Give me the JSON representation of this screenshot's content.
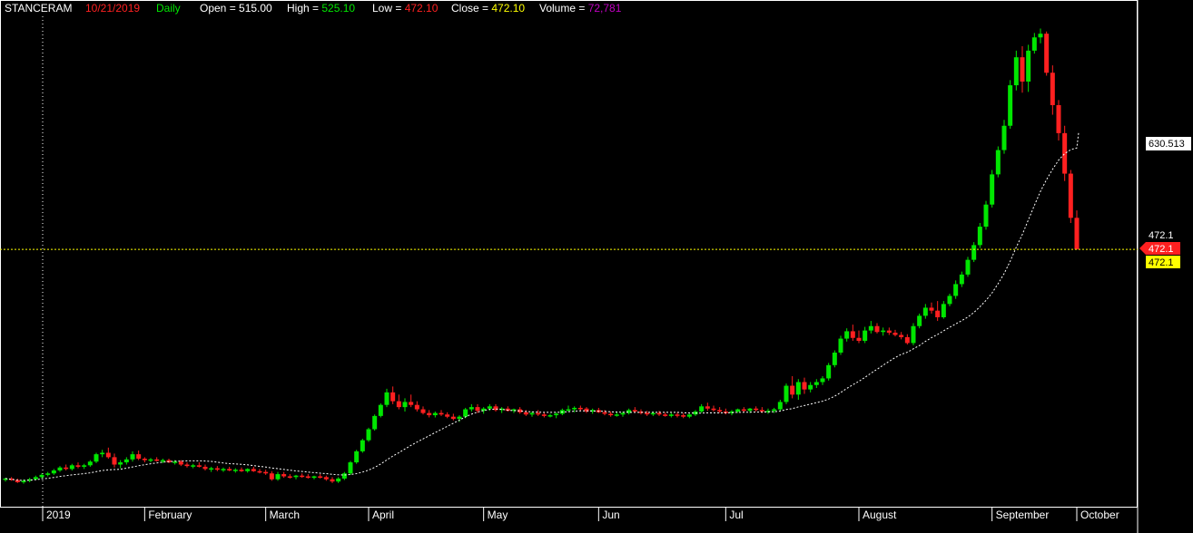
{
  "header": {
    "symbol": "STANCERAM",
    "date": "10/21/2019",
    "period": "Daily",
    "open_label": "Open = 515.00",
    "high_label": "High = ",
    "high_value": "525.10",
    "low_label": "Low = ",
    "low_value": "472.10",
    "close_label": "Close = ",
    "close_value": "472.10",
    "volume_label": "Volume = ",
    "volume_value": "72,781"
  },
  "price_axis": {
    "ma_value_label": "630.513",
    "last_price_label": "472.1",
    "close_marker_label": "472.1",
    "yellow_marker_label": "472.1"
  },
  "colors": {
    "up": "#00e600",
    "down": "#ff2020",
    "background": "#000000",
    "frame": "#ffffff",
    "date_red": "#ff2020",
    "period_green": "#00e600",
    "high_green": "#00e600",
    "low_red": "#ff2020",
    "close_yellow": "#ffff00",
    "volume_magenta": "#c000c0",
    "price_line": "#ffff00"
  },
  "chart_data": {
    "type": "candlestick",
    "x_axis_labels": [
      "2019",
      "February",
      "March",
      "April",
      "May",
      "Jun",
      "Jul",
      "August",
      "September",
      "October"
    ],
    "y_range": [
      140,
      780
    ],
    "overlay": "moving-average (dotted white)",
    "last_close": 472.1,
    "ma_last": 630.513,
    "candles": [
      {
        "o": 160,
        "h": 162,
        "l": 157,
        "c": 161
      },
      {
        "o": 161,
        "h": 163,
        "l": 158,
        "c": 159
      },
      {
        "o": 159,
        "h": 161,
        "l": 155,
        "c": 156
      },
      {
        "o": 156,
        "h": 160,
        "l": 154,
        "c": 158
      },
      {
        "o": 158,
        "h": 162,
        "l": 156,
        "c": 160
      },
      {
        "o": 160,
        "h": 165,
        "l": 159,
        "c": 163
      },
      {
        "o": 163,
        "h": 168,
        "l": 161,
        "c": 166
      },
      {
        "o": 166,
        "h": 170,
        "l": 164,
        "c": 168
      },
      {
        "o": 168,
        "h": 174,
        "l": 166,
        "c": 172
      },
      {
        "o": 172,
        "h": 178,
        "l": 170,
        "c": 176
      },
      {
        "o": 176,
        "h": 180,
        "l": 172,
        "c": 174
      },
      {
        "o": 174,
        "h": 181,
        "l": 172,
        "c": 179
      },
      {
        "o": 179,
        "h": 183,
        "l": 175,
        "c": 177
      },
      {
        "o": 177,
        "h": 181,
        "l": 174,
        "c": 179
      },
      {
        "o": 179,
        "h": 186,
        "l": 177,
        "c": 184
      },
      {
        "o": 184,
        "h": 196,
        "l": 182,
        "c": 194
      },
      {
        "o": 194,
        "h": 200,
        "l": 190,
        "c": 196
      },
      {
        "o": 196,
        "h": 203,
        "l": 188,
        "c": 190
      },
      {
        "o": 190,
        "h": 195,
        "l": 176,
        "c": 180
      },
      {
        "o": 180,
        "h": 186,
        "l": 175,
        "c": 183
      },
      {
        "o": 183,
        "h": 190,
        "l": 180,
        "c": 187
      },
      {
        "o": 187,
        "h": 198,
        "l": 184,
        "c": 194
      },
      {
        "o": 194,
        "h": 199,
        "l": 186,
        "c": 188
      },
      {
        "o": 188,
        "h": 190,
        "l": 183,
        "c": 186
      },
      {
        "o": 186,
        "h": 189,
        "l": 183,
        "c": 187
      },
      {
        "o": 187,
        "h": 190,
        "l": 184,
        "c": 185
      },
      {
        "o": 185,
        "h": 188,
        "l": 182,
        "c": 186
      },
      {
        "o": 186,
        "h": 188,
        "l": 182,
        "c": 183
      },
      {
        "o": 183,
        "h": 186,
        "l": 180,
        "c": 184
      },
      {
        "o": 184,
        "h": 186,
        "l": 178,
        "c": 180
      },
      {
        "o": 180,
        "h": 183,
        "l": 176,
        "c": 178
      },
      {
        "o": 178,
        "h": 181,
        "l": 175,
        "c": 179
      },
      {
        "o": 179,
        "h": 183,
        "l": 176,
        "c": 177
      },
      {
        "o": 177,
        "h": 180,
        "l": 172,
        "c": 174
      },
      {
        "o": 174,
        "h": 177,
        "l": 170,
        "c": 175
      },
      {
        "o": 175,
        "h": 178,
        "l": 171,
        "c": 173
      },
      {
        "o": 173,
        "h": 176,
        "l": 170,
        "c": 174
      },
      {
        "o": 174,
        "h": 177,
        "l": 171,
        "c": 172
      },
      {
        "o": 172,
        "h": 175,
        "l": 169,
        "c": 173
      },
      {
        "o": 173,
        "h": 176,
        "l": 170,
        "c": 171
      },
      {
        "o": 171,
        "h": 175,
        "l": 169,
        "c": 174
      },
      {
        "o": 174,
        "h": 177,
        "l": 170,
        "c": 171
      },
      {
        "o": 171,
        "h": 174,
        "l": 168,
        "c": 170
      },
      {
        "o": 170,
        "h": 173,
        "l": 166,
        "c": 168
      },
      {
        "o": 168,
        "h": 171,
        "l": 158,
        "c": 160
      },
      {
        "o": 160,
        "h": 170,
        "l": 158,
        "c": 167
      },
      {
        "o": 167,
        "h": 170,
        "l": 162,
        "c": 164
      },
      {
        "o": 164,
        "h": 167,
        "l": 161,
        "c": 163
      },
      {
        "o": 163,
        "h": 166,
        "l": 160,
        "c": 165
      },
      {
        "o": 165,
        "h": 168,
        "l": 162,
        "c": 164
      },
      {
        "o": 164,
        "h": 167,
        "l": 161,
        "c": 162
      },
      {
        "o": 162,
        "h": 165,
        "l": 160,
        "c": 164
      },
      {
        "o": 164,
        "h": 167,
        "l": 161,
        "c": 163
      },
      {
        "o": 163,
        "h": 165,
        "l": 158,
        "c": 160
      },
      {
        "o": 160,
        "h": 163,
        "l": 155,
        "c": 157
      },
      {
        "o": 157,
        "h": 163,
        "l": 155,
        "c": 161
      },
      {
        "o": 161,
        "h": 170,
        "l": 159,
        "c": 168
      },
      {
        "o": 168,
        "h": 185,
        "l": 166,
        "c": 183
      },
      {
        "o": 183,
        "h": 200,
        "l": 181,
        "c": 198
      },
      {
        "o": 198,
        "h": 215,
        "l": 196,
        "c": 213
      },
      {
        "o": 213,
        "h": 230,
        "l": 211,
        "c": 228
      },
      {
        "o": 228,
        "h": 248,
        "l": 226,
        "c": 246
      },
      {
        "o": 246,
        "h": 263,
        "l": 244,
        "c": 261
      },
      {
        "o": 261,
        "h": 283,
        "l": 258,
        "c": 278
      },
      {
        "o": 278,
        "h": 286,
        "l": 262,
        "c": 266
      },
      {
        "o": 266,
        "h": 275,
        "l": 255,
        "c": 258
      },
      {
        "o": 258,
        "h": 270,
        "l": 252,
        "c": 265
      },
      {
        "o": 265,
        "h": 275,
        "l": 258,
        "c": 261
      },
      {
        "o": 261,
        "h": 266,
        "l": 252,
        "c": 255
      },
      {
        "o": 255,
        "h": 259,
        "l": 248,
        "c": 250
      },
      {
        "o": 250,
        "h": 254,
        "l": 244,
        "c": 247
      },
      {
        "o": 247,
        "h": 252,
        "l": 244,
        "c": 250
      },
      {
        "o": 250,
        "h": 254,
        "l": 246,
        "c": 248
      },
      {
        "o": 248,
        "h": 251,
        "l": 243,
        "c": 245
      },
      {
        "o": 245,
        "h": 249,
        "l": 240,
        "c": 242
      },
      {
        "o": 242,
        "h": 247,
        "l": 238,
        "c": 245
      },
      {
        "o": 245,
        "h": 257,
        "l": 243,
        "c": 255
      },
      {
        "o": 255,
        "h": 262,
        "l": 252,
        "c": 258
      },
      {
        "o": 258,
        "h": 262,
        "l": 250,
        "c": 253
      },
      {
        "o": 253,
        "h": 258,
        "l": 249,
        "c": 256
      },
      {
        "o": 256,
        "h": 262,
        "l": 253,
        "c": 259
      },
      {
        "o": 259,
        "h": 262,
        "l": 252,
        "c": 254
      },
      {
        "o": 254,
        "h": 258,
        "l": 250,
        "c": 256
      },
      {
        "o": 256,
        "h": 259,
        "l": 252,
        "c": 253
      },
      {
        "o": 253,
        "h": 256,
        "l": 250,
        "c": 255
      },
      {
        "o": 255,
        "h": 258,
        "l": 249,
        "c": 251
      },
      {
        "o": 251,
        "h": 254,
        "l": 246,
        "c": 248
      },
      {
        "o": 248,
        "h": 252,
        "l": 245,
        "c": 250
      },
      {
        "o": 250,
        "h": 254,
        "l": 246,
        "c": 248
      },
      {
        "o": 248,
        "h": 251,
        "l": 244,
        "c": 246
      },
      {
        "o": 246,
        "h": 249,
        "l": 244,
        "c": 247
      },
      {
        "o": 247,
        "h": 251,
        "l": 243,
        "c": 249
      },
      {
        "o": 249,
        "h": 256,
        "l": 247,
        "c": 254
      },
      {
        "o": 254,
        "h": 260,
        "l": 252,
        "c": 255
      },
      {
        "o": 255,
        "h": 259,
        "l": 251,
        "c": 257
      },
      {
        "o": 257,
        "h": 260,
        "l": 253,
        "c": 256
      },
      {
        "o": 256,
        "h": 258,
        "l": 250,
        "c": 252
      },
      {
        "o": 252,
        "h": 256,
        "l": 249,
        "c": 254
      },
      {
        "o": 254,
        "h": 257,
        "l": 250,
        "c": 251
      },
      {
        "o": 251,
        "h": 254,
        "l": 247,
        "c": 249
      },
      {
        "o": 249,
        "h": 252,
        "l": 245,
        "c": 247
      },
      {
        "o": 247,
        "h": 251,
        "l": 245,
        "c": 248
      },
      {
        "o": 248,
        "h": 252,
        "l": 245,
        "c": 250
      },
      {
        "o": 250,
        "h": 256,
        "l": 248,
        "c": 254
      },
      {
        "o": 254,
        "h": 258,
        "l": 250,
        "c": 252
      },
      {
        "o": 252,
        "h": 255,
        "l": 248,
        "c": 250
      },
      {
        "o": 250,
        "h": 253,
        "l": 246,
        "c": 249
      },
      {
        "o": 249,
        "h": 252,
        "l": 246,
        "c": 250
      },
      {
        "o": 250,
        "h": 253,
        "l": 246,
        "c": 248
      },
      {
        "o": 248,
        "h": 251,
        "l": 245,
        "c": 246
      },
      {
        "o": 246,
        "h": 250,
        "l": 244,
        "c": 248
      },
      {
        "o": 248,
        "h": 251,
        "l": 244,
        "c": 247
      },
      {
        "o": 247,
        "h": 250,
        "l": 243,
        "c": 245
      },
      {
        "o": 245,
        "h": 249,
        "l": 243,
        "c": 248
      },
      {
        "o": 248,
        "h": 254,
        "l": 246,
        "c": 252
      },
      {
        "o": 252,
        "h": 262,
        "l": 250,
        "c": 259
      },
      {
        "o": 259,
        "h": 264,
        "l": 253,
        "c": 256
      },
      {
        "o": 256,
        "h": 260,
        "l": 252,
        "c": 254
      },
      {
        "o": 254,
        "h": 258,
        "l": 250,
        "c": 252
      },
      {
        "o": 252,
        "h": 256,
        "l": 248,
        "c": 250
      },
      {
        "o": 250,
        "h": 254,
        "l": 247,
        "c": 252
      },
      {
        "o": 252,
        "h": 256,
        "l": 250,
        "c": 255
      },
      {
        "o": 255,
        "h": 258,
        "l": 251,
        "c": 253
      },
      {
        "o": 253,
        "h": 257,
        "l": 250,
        "c": 256
      },
      {
        "o": 256,
        "h": 259,
        "l": 252,
        "c": 254
      },
      {
        "o": 254,
        "h": 258,
        "l": 250,
        "c": 252
      },
      {
        "o": 252,
        "h": 256,
        "l": 249,
        "c": 253
      },
      {
        "o": 253,
        "h": 257,
        "l": 250,
        "c": 255
      },
      {
        "o": 255,
        "h": 268,
        "l": 253,
        "c": 265
      },
      {
        "o": 265,
        "h": 290,
        "l": 262,
        "c": 287
      },
      {
        "o": 287,
        "h": 300,
        "l": 270,
        "c": 275
      },
      {
        "o": 275,
        "h": 296,
        "l": 268,
        "c": 292
      },
      {
        "o": 292,
        "h": 298,
        "l": 276,
        "c": 282
      },
      {
        "o": 282,
        "h": 292,
        "l": 278,
        "c": 288
      },
      {
        "o": 288,
        "h": 296,
        "l": 284,
        "c": 292
      },
      {
        "o": 292,
        "h": 300,
        "l": 288,
        "c": 297
      },
      {
        "o": 297,
        "h": 318,
        "l": 294,
        "c": 315
      },
      {
        "o": 315,
        "h": 335,
        "l": 312,
        "c": 332
      },
      {
        "o": 332,
        "h": 355,
        "l": 329,
        "c": 351
      },
      {
        "o": 351,
        "h": 365,
        "l": 347,
        "c": 361
      },
      {
        "o": 361,
        "h": 370,
        "l": 348,
        "c": 352
      },
      {
        "o": 352,
        "h": 362,
        "l": 345,
        "c": 348
      },
      {
        "o": 348,
        "h": 367,
        "l": 345,
        "c": 362
      },
      {
        "o": 362,
        "h": 375,
        "l": 358,
        "c": 368
      },
      {
        "o": 368,
        "h": 372,
        "l": 358,
        "c": 360
      },
      {
        "o": 360,
        "h": 366,
        "l": 355,
        "c": 362
      },
      {
        "o": 362,
        "h": 366,
        "l": 356,
        "c": 359
      },
      {
        "o": 359,
        "h": 363,
        "l": 354,
        "c": 356
      },
      {
        "o": 356,
        "h": 360,
        "l": 350,
        "c": 353
      },
      {
        "o": 353,
        "h": 357,
        "l": 343,
        "c": 345
      },
      {
        "o": 345,
        "h": 372,
        "l": 342,
        "c": 368
      },
      {
        "o": 368,
        "h": 385,
        "l": 365,
        "c": 382
      },
      {
        "o": 382,
        "h": 398,
        "l": 378,
        "c": 393
      },
      {
        "o": 393,
        "h": 400,
        "l": 385,
        "c": 389
      },
      {
        "o": 389,
        "h": 402,
        "l": 375,
        "c": 380
      },
      {
        "o": 380,
        "h": 402,
        "l": 378,
        "c": 398
      },
      {
        "o": 398,
        "h": 412,
        "l": 395,
        "c": 409
      },
      {
        "o": 409,
        "h": 430,
        "l": 405,
        "c": 425
      },
      {
        "o": 425,
        "h": 442,
        "l": 421,
        "c": 438
      },
      {
        "o": 438,
        "h": 462,
        "l": 435,
        "c": 458
      },
      {
        "o": 458,
        "h": 482,
        "l": 455,
        "c": 478
      },
      {
        "o": 478,
        "h": 508,
        "l": 474,
        "c": 503
      },
      {
        "o": 503,
        "h": 538,
        "l": 499,
        "c": 533
      },
      {
        "o": 533,
        "h": 580,
        "l": 529,
        "c": 574
      },
      {
        "o": 574,
        "h": 612,
        "l": 570,
        "c": 607
      },
      {
        "o": 607,
        "h": 648,
        "l": 602,
        "c": 640
      },
      {
        "o": 640,
        "h": 702,
        "l": 636,
        "c": 695
      },
      {
        "o": 695,
        "h": 742,
        "l": 688,
        "c": 733
      },
      {
        "o": 733,
        "h": 748,
        "l": 685,
        "c": 700
      },
      {
        "o": 700,
        "h": 750,
        "l": 686,
        "c": 742
      },
      {
        "o": 742,
        "h": 766,
        "l": 738,
        "c": 760
      },
      {
        "o": 760,
        "h": 772,
        "l": 752,
        "c": 765
      },
      {
        "o": 765,
        "h": 768,
        "l": 708,
        "c": 712
      },
      {
        "o": 712,
        "h": 722,
        "l": 655,
        "c": 668
      },
      {
        "o": 668,
        "h": 675,
        "l": 620,
        "c": 630
      },
      {
        "o": 630,
        "h": 640,
        "l": 565,
        "c": 575
      },
      {
        "o": 575,
        "h": 580,
        "l": 508,
        "c": 515
      },
      {
        "o": 515,
        "h": 525.1,
        "l": 472.1,
        "c": 472.1
      }
    ]
  }
}
